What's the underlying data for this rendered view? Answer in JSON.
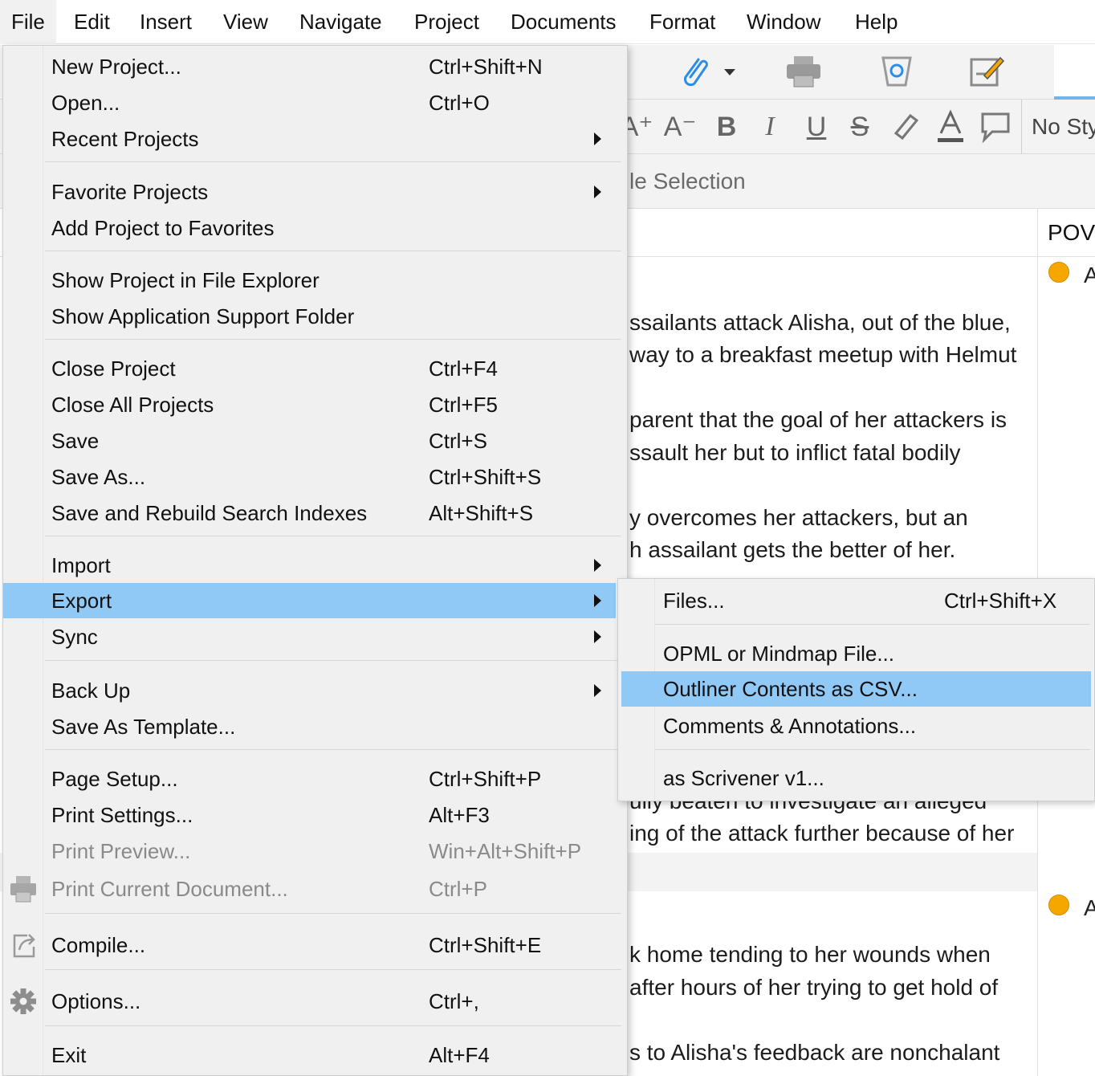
{
  "menubar": {
    "items": [
      "File",
      "Edit",
      "Insert",
      "View",
      "Navigate",
      "Project",
      "Documents",
      "Format",
      "Window",
      "Help"
    ],
    "active": "File"
  },
  "toolbar": {
    "icons": [
      "paperclip-icon",
      "print-icon",
      "recycle-trash-icon",
      "edit-note-icon"
    ],
    "format_buttons": [
      "A⁺",
      "A⁻",
      "B",
      "I",
      "U",
      "S"
    ],
    "style_select": "No Sty"
  },
  "selection_bar": {
    "label": "le Selection"
  },
  "outline": {
    "pov_header": "POV",
    "row1": {
      "pov_letter": "A",
      "synopsis_lines": [
        "ssailants attack Alisha, out of the blue,",
        "way to a breakfast meetup with Helmut",
        "parent that the goal of her attackers is",
        "ssault her but to inflict fatal bodily",
        "y overcomes her attackers, but an",
        "h assailant gets the better of her.",
        "ully beaten to investigate an alleged",
        "ing of the attack further because of her"
      ]
    },
    "row2": {
      "pov_letter": "A",
      "synopsis_lines": [
        "k home tending to her wounds when",
        "after hours of her trying to get hold of",
        "s to Alisha's feedback are nonchalant"
      ]
    }
  },
  "file_menu": {
    "items": [
      {
        "label": "New Project...",
        "shortcut": "Ctrl+Shift+N"
      },
      {
        "label": "Open...",
        "shortcut": "Ctrl+O"
      },
      {
        "label": "Recent Projects",
        "submenu": true
      },
      {
        "label": "Favorite Projects",
        "submenu": true
      },
      {
        "label": "Add Project to Favorites"
      },
      {
        "label": "Show Project in File Explorer"
      },
      {
        "label": "Show Application Support Folder"
      },
      {
        "label": "Close Project",
        "shortcut": "Ctrl+F4"
      },
      {
        "label": "Close All Projects",
        "shortcut": "Ctrl+F5"
      },
      {
        "label": "Save",
        "shortcut": "Ctrl+S"
      },
      {
        "label": "Save As...",
        "shortcut": "Ctrl+Shift+S"
      },
      {
        "label": "Save and Rebuild Search Indexes",
        "shortcut": "Alt+Shift+S"
      },
      {
        "label": "Import",
        "submenu": true
      },
      {
        "label": "Export",
        "submenu": true,
        "highlighted": true
      },
      {
        "label": "Sync",
        "submenu": true
      },
      {
        "label": "Back Up",
        "submenu": true
      },
      {
        "label": "Save As Template..."
      },
      {
        "label": "Page Setup...",
        "shortcut": "Ctrl+Shift+P"
      },
      {
        "label": "Print Settings...",
        "shortcut": "Alt+F3"
      },
      {
        "label": "Print Preview...",
        "shortcut": "Win+Alt+Shift+P",
        "disabled": true
      },
      {
        "label": "Print Current Document...",
        "shortcut": "Ctrl+P",
        "disabled": true,
        "icon": "printer-icon"
      },
      {
        "label": "Compile...",
        "shortcut": "Ctrl+Shift+E",
        "icon": "compile-share-icon"
      },
      {
        "label": "Options...",
        "shortcut": "Ctrl+,",
        "icon": "gear-icon"
      },
      {
        "label": "Exit",
        "shortcut": "Alt+F4"
      }
    ]
  },
  "export_menu": {
    "items": [
      {
        "label": "Files...",
        "shortcut": "Ctrl+Shift+X"
      },
      {
        "label": "OPML or Mindmap File..."
      },
      {
        "label": "Outliner Contents as CSV...",
        "highlighted": true
      },
      {
        "label": "Comments & Annotations..."
      },
      {
        "label": "as Scrivener v1..."
      }
    ]
  },
  "colors": {
    "highlight": "#90c8f6",
    "menu_bg": "#f0f0f0",
    "pov_dot": "#f5a700",
    "tab_underline": "#6fb5ee",
    "icon_blue": "#2b8ee6"
  }
}
